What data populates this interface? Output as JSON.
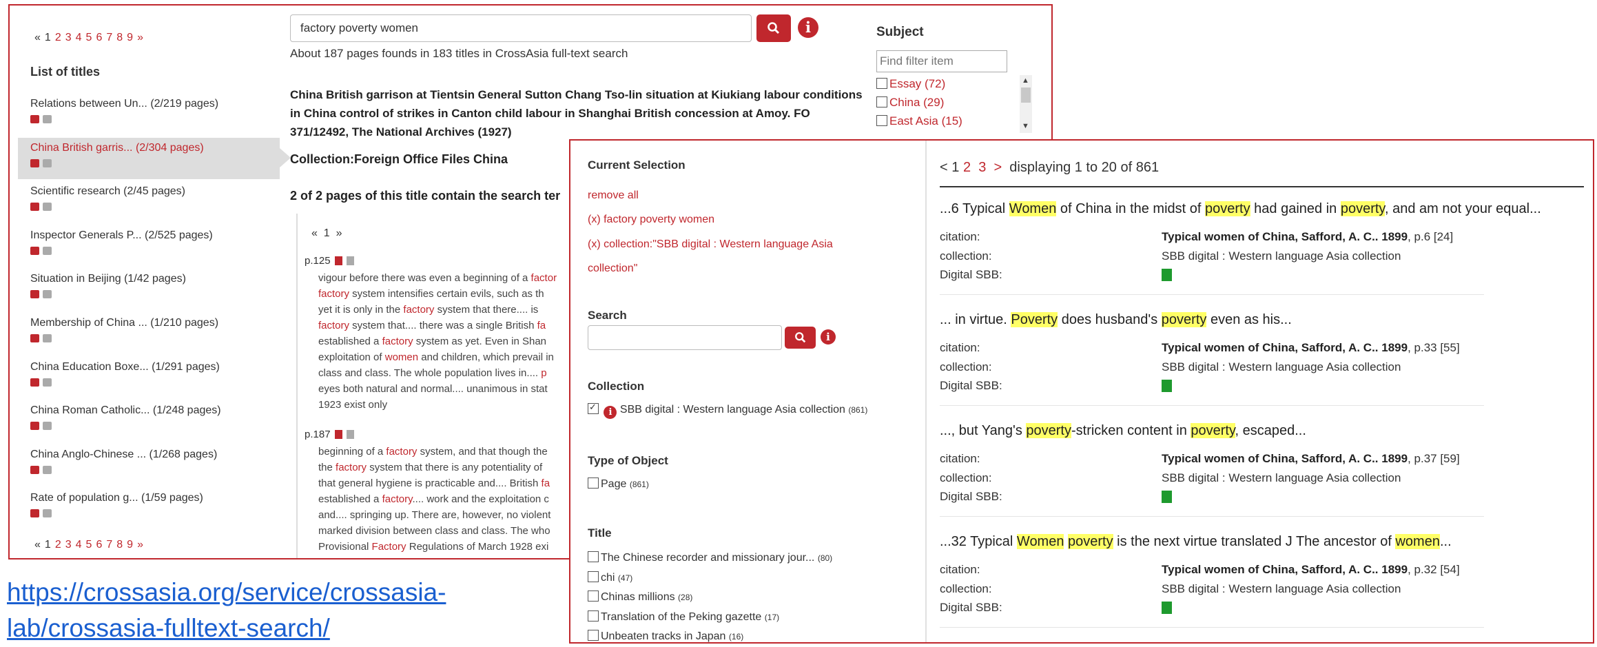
{
  "shot1": {
    "pager": {
      "prev": "«",
      "current": "1",
      "pages": [
        "2",
        "3",
        "4",
        "5",
        "6",
        "7",
        "8",
        "9"
      ],
      "next": "»"
    },
    "list_title": "List of titles",
    "titles": [
      {
        "label": "Relations between Un... (2/219 pages)",
        "active": false
      },
      {
        "label": "China British garris... (2/304 pages)",
        "active": true
      },
      {
        "label": "Scientific research (2/45 pages)",
        "active": false
      },
      {
        "label": "Inspector Generals P... (2/525 pages)",
        "active": false
      },
      {
        "label": "Situation in Beijing (1/42 pages)",
        "active": false
      },
      {
        "label": "Membership of China ... (1/210 pages)",
        "active": false
      },
      {
        "label": "China Education Boxe... (1/291 pages)",
        "active": false
      },
      {
        "label": "China Roman Catholic... (1/248 pages)",
        "active": false
      },
      {
        "label": "China Anglo-Chinese ... (1/268 pages)",
        "active": false
      },
      {
        "label": "Rate of population g... (1/59 pages)",
        "active": false
      }
    ],
    "search_value": "factory poverty women",
    "about": "About 187 pages founds in 183 titles in CrossAsia full-text search",
    "doc_title": "China British garrison at Tientsin General Sutton Chang Tso-lin situation at Kiukiang labour conditions in China control of strikes in Canton child labour in Shanghai British concession at Amoy. FO 371/12492, The National Archives (1927)",
    "collection": "Collection:Foreign Office Files China",
    "pages_line": "2 of 2 pages of this title contain the search ter",
    "inner_pager": {
      "prev": "«",
      "current": "1",
      "next": "»"
    },
    "hits": [
      {
        "page": "p.125",
        "lines": [
          [
            {
              "t": "vigour before there was even a beginning of a "
            },
            {
              "t": "factor",
              "m": true
            }
          ],
          [
            {
              "t": "factory",
              "m": true
            },
            {
              "t": " system intensifies certain evils, such as th"
            }
          ],
          [
            {
              "t": "yet it is only in the "
            },
            {
              "t": "factory",
              "m": true
            },
            {
              "t": " system that there.... is"
            }
          ],
          [
            {
              "t": "factory",
              "m": true
            },
            {
              "t": " system that.... there was a single British "
            },
            {
              "t": "fa",
              "m": true
            }
          ],
          [
            {
              "t": "established a "
            },
            {
              "t": "factory",
              "m": true
            },
            {
              "t": " system as yet. Even in Shan"
            }
          ],
          [
            {
              "t": "exploitation of "
            },
            {
              "t": "women",
              "m": true
            },
            {
              "t": " and children, which prevail in"
            }
          ],
          [
            {
              "t": "class and class. The whole population lives in.... "
            },
            {
              "t": "p",
              "m": true
            }
          ],
          [
            {
              "t": "eyes both natural and normal.... unanimous in stat"
            }
          ],
          [
            {
              "t": "1923 exist only"
            }
          ]
        ]
      },
      {
        "page": "p.187",
        "lines": [
          [
            {
              "t": "beginning of a "
            },
            {
              "t": "factory",
              "m": true
            },
            {
              "t": " system, and that though the"
            }
          ],
          [
            {
              "t": "the "
            },
            {
              "t": "factory",
              "m": true
            },
            {
              "t": " system that there is any potentiality of"
            }
          ],
          [
            {
              "t": "that general hygiene is practicable and.... British "
            },
            {
              "t": "fa",
              "m": true
            }
          ],
          [
            {
              "t": "established a "
            },
            {
              "t": "factory",
              "m": true
            },
            {
              "t": ".... work and the exploitation c"
            }
          ],
          [
            {
              "t": "and.... springing up. There are, however, no violent"
            }
          ],
          [
            {
              "t": "marked division between class and class. The who"
            }
          ],
          [
            {
              "t": "Provisional "
            },
            {
              "t": "Factory",
              "m": true
            },
            {
              "t": " Regulations of March 1928 exi"
            }
          ]
        ]
      }
    ],
    "subject_head": "Subject",
    "filter_placeholder": "Find filter item",
    "facets": [
      "Essay (72)",
      "China (29)",
      "East Asia (15)"
    ]
  },
  "link": {
    "line1": "https://crossasia.org/service/crossasia-",
    "line2": "lab/crossasia-fulltext-search/"
  },
  "shot2": {
    "current_selection": "Current Selection",
    "remove_all": "remove all",
    "sel_query": "(x) factory poverty women",
    "sel_collection_1": "(x) collection:\"SBB digital : Western language Asia",
    "sel_collection_2": "collection\"",
    "search_head": "Search",
    "collection_head": "Collection",
    "collection_item": "SBB digital : Western language Asia collection",
    "collection_count": "(861)",
    "type_head": "Type of Object",
    "type_item": "Page",
    "type_count": "(861)",
    "title_head": "Title",
    "title_items": [
      {
        "label": "The Chinese recorder and missionary jour...",
        "count": "(80)"
      },
      {
        "label": "chi",
        "count": "(47)"
      },
      {
        "label": "Chinas millions",
        "count": "(28)"
      },
      {
        "label": "Translation of the Peking gazette",
        "count": "(17)"
      },
      {
        "label": "Unbeaten tracks in Japan",
        "count": "(16)"
      }
    ],
    "res_pager": {
      "prev": "<",
      "current": "1",
      "p2": "2",
      "p3": "3",
      "next": ">",
      "display": "displaying 1 to 20 of 861"
    },
    "meta_labels": {
      "citation": "citation:",
      "collection": "collection:",
      "digital": "Digital SBB:"
    },
    "results": [
      {
        "snippet": [
          {
            "t": "...6 Typical "
          },
          {
            "t": "Women",
            "h": true
          },
          {
            "t": " of China in the midst of "
          },
          {
            "t": "poverty",
            "h": true
          },
          {
            "t": " had gained in "
          },
          {
            "t": "poverty",
            "h": true
          },
          {
            "t": ", and am not your equal..."
          }
        ],
        "cite_bold": "Typical women of China, Safford, A. C.. 1899",
        "cite_rest": ", p.6 [24]",
        "collection": "SBB digital : Western language Asia collection"
      },
      {
        "snippet": [
          {
            "t": "... in virtue. "
          },
          {
            "t": "Poverty",
            "h": true
          },
          {
            "t": " does husband's "
          },
          {
            "t": "poverty",
            "h": true
          },
          {
            "t": " even as his..."
          }
        ],
        "cite_bold": "Typical women of China, Safford, A. C.. 1899",
        "cite_rest": ", p.33 [55]",
        "collection": "SBB digital : Western language Asia collection"
      },
      {
        "snippet": [
          {
            "t": "..., but Yang's "
          },
          {
            "t": "poverty",
            "h": true
          },
          {
            "t": "-stricken content in "
          },
          {
            "t": "poverty",
            "h": true
          },
          {
            "t": ", escaped..."
          }
        ],
        "cite_bold": "Typical women of China, Safford, A. C.. 1899",
        "cite_rest": ", p.37 [59]",
        "collection": "SBB digital : Western language Asia collection"
      },
      {
        "snippet": [
          {
            "t": "...32 Typical "
          },
          {
            "t": "Women",
            "h": true
          },
          {
            "t": " "
          },
          {
            "t": "poverty",
            "h": true
          },
          {
            "t": " is the next virtue translated J The ancestor of "
          },
          {
            "t": "women",
            "h": true
          },
          {
            "t": "..."
          }
        ],
        "cite_bold": "Typical women of China, Safford, A. C.. 1899",
        "cite_rest": ", p.32 [54]",
        "collection": "SBB digital : Western language Asia collection"
      }
    ]
  },
  "colors": {
    "accent": "#c0272d",
    "highlight": "#ffff66",
    "link": "#1a5fd0",
    "pdf_green": "#1e9a2e"
  }
}
